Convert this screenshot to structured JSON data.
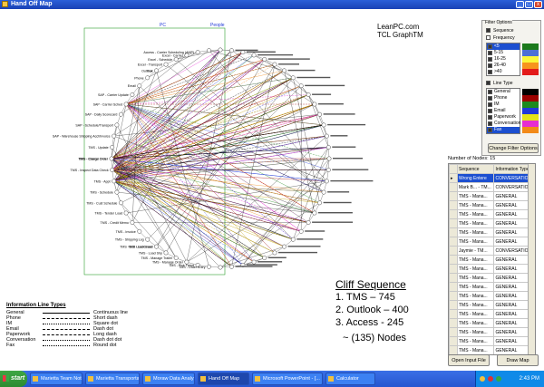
{
  "window": {
    "title": "Hand Off Map"
  },
  "graph": {
    "group_pc": "PC",
    "group_people": "People",
    "left_nodes": [
      "TMS - Order Entry",
      "TMS - Pick Ticket",
      "TMS - Manage Order",
      "TMS - Manage Trailer",
      "TMS - Load Shp",
      "TMS - Lock Load",
      "TMS - Edit Load Sheet",
      "TMS - Shipping Log",
      "TMS - Invoice",
      "TMS - Credit Memo",
      "TMS - Tender Load",
      "TMS - Cust Schedule",
      "TMS - Schedule",
      "TMS - Appt",
      "TMS - Inspect Data Check",
      "TMS - Charge Order",
      "TMS - Cancel Order",
      "TMS - Update",
      "SAP - Warehouse Shipping Acct/Invoice",
      "SAP - Schedule/Transport",
      "SAP - Daily Scorecard",
      "SAP - Carrier Sched",
      "SAP - Carrier Update",
      "Email",
      "Phone",
      "Fax",
      "Outlook",
      "Excel - Transport",
      "Excel - Schedule",
      "Excel - Carrier",
      "Access - Carrier Scheduling (AMP)"
    ]
  },
  "logo": {
    "line1": "LeanPC.com",
    "line2": "TCL GraphTM"
  },
  "filter": {
    "caption": "Filter Options",
    "sequence_label": "Sequence",
    "frequency_label": "Frequency",
    "frequency_items": [
      {
        "label": "<5",
        "color": "#1c7a1c"
      },
      {
        "label": "5-15",
        "color": "#4d6fd6"
      },
      {
        "label": "16-25",
        "color": "#fbf73a"
      },
      {
        "label": "26-40",
        "color": "#f7941d"
      },
      {
        "label": ">40",
        "color": "#e31b1b"
      }
    ],
    "line_type_label": "Line Type",
    "line_types": [
      {
        "label": "General",
        "color": "#000000"
      },
      {
        "label": "Phone",
        "color": "#9b0000"
      },
      {
        "label": "IM",
        "color": "#1d8a1d"
      },
      {
        "label": "Email",
        "color": "#2038d8"
      },
      {
        "label": "Paperwork",
        "color": "#e4e418"
      },
      {
        "label": "Conversation",
        "color": "#e62bd2"
      },
      {
        "label": "Fax",
        "color": "#f28a18"
      }
    ],
    "change_button": "Change Filter Options"
  },
  "nodes_info": {
    "label": "Number of Nodes: 15"
  },
  "grid": {
    "headers": [
      "Sequence",
      "Information Type"
    ],
    "rows": [
      [
        "Wrong Entere",
        "CONVERSATION"
      ],
      [
        "Mark B... - TM...",
        "CONVERSATION"
      ],
      [
        "TMS - Mana...",
        "GENERAL"
      ],
      [
        "TMS - Mana...",
        "GENERAL"
      ],
      [
        "TMS - Mana...",
        "GENERAL"
      ],
      [
        "TMS - Mana...",
        "GENERAL"
      ],
      [
        "TMS - Mana...",
        "GENERAL"
      ],
      [
        "TMS - Mana...",
        "GENERAL"
      ],
      [
        "Jaymie - TM...",
        "CONVERSATION"
      ],
      [
        "TMS - Mana...",
        "GENERAL"
      ],
      [
        "TMS - Mana...",
        "GENERAL"
      ],
      [
        "TMS - Mana...",
        "GENERAL"
      ],
      [
        "TMS - Mana...",
        "GENERAL"
      ],
      [
        "TMS - Mana...",
        "GENERAL"
      ],
      [
        "TMS - Mana...",
        "GENERAL"
      ],
      [
        "TMS - Mana...",
        "GENERAL"
      ],
      [
        "TMS - Mana...",
        "GENERAL"
      ],
      [
        "TMS - Mana...",
        "GENERAL"
      ],
      [
        "TMS - Mana...",
        "GENERAL"
      ],
      [
        "TMS - Mana...",
        "GENERAL"
      ],
      [
        "TMS - Mana...",
        "GENERAL"
      ],
      [
        "TMS - Mana...",
        "GENERAL"
      ]
    ]
  },
  "buttons": {
    "open_input": "Open Input File",
    "draw_map": "Draw Map"
  },
  "legend": {
    "title": "Information Line Types",
    "items": [
      {
        "type": "General",
        "style": "Continuous line",
        "dash": "solid"
      },
      {
        "type": "Phone",
        "style": "Short dash",
        "dash": "dashed"
      },
      {
        "type": "IM",
        "style": "Square dot",
        "dash": "dotted"
      },
      {
        "type": "Email",
        "style": "Dash dot",
        "dash": "dashed"
      },
      {
        "type": "Paperwork",
        "style": "Long dash",
        "dash": "dashed"
      },
      {
        "type": "Conversation",
        "style": "Dash dot dot",
        "dash": "dotted"
      },
      {
        "type": "Fax",
        "style": "Round dot",
        "dash": "dotted"
      }
    ]
  },
  "cliff": {
    "title": "Cliff Sequence",
    "items": [
      "1.  TMS – 745",
      "2.  Outlook – 400",
      "3.  Access - 245"
    ],
    "nodes": "~ (135) Nodes"
  },
  "taskbar": {
    "start": "start",
    "tasks": [
      "Marietta Team Notes",
      "Marietta Transportation ...",
      "Moraw Data Analysis (1.xls",
      "Hand Off Map",
      "Microsoft PowerPoint - [...",
      "Calculator"
    ],
    "active_index": 3,
    "clock": "2:43 PM"
  }
}
